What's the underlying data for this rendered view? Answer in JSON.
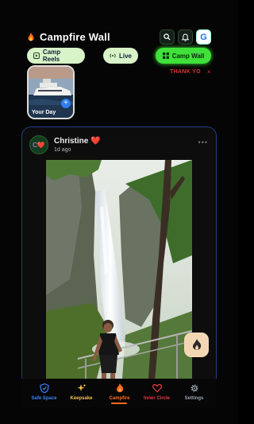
{
  "header": {
    "title": "Campfire Wall",
    "icons": [
      "search-icon",
      "bell-icon",
      "g-logo"
    ],
    "g_letter": "G"
  },
  "nav_chips": [
    {
      "label": "Camp Reels",
      "icon": "play-icon"
    },
    {
      "label": "Live",
      "icon": "broadcast-icon"
    },
    {
      "label": "Camp Wall",
      "icon": "grid-icon"
    }
  ],
  "notice": {
    "text": "THANK YO",
    "close": "×"
  },
  "story": {
    "label": "Your Day",
    "add": "+"
  },
  "post": {
    "author": "Christine ❤️",
    "time": "1d ago",
    "avatar_initial": "C❤️",
    "more": "•••"
  },
  "bottom_nav": [
    {
      "label": "Safe Space",
      "icon": "shield-icon",
      "color": "#3b82f6"
    },
    {
      "label": "Keepsake",
      "icon": "sparkle-icon",
      "color": "#f5c542"
    },
    {
      "label": "Campfire",
      "icon": "flame-icon",
      "color": "#ff6a1a"
    },
    {
      "label": "Inner Circle",
      "icon": "heart-icon",
      "color": "#e53945"
    },
    {
      "label": "Settings",
      "icon": "gear-icon",
      "color": "#9ca3af"
    }
  ],
  "colors": {
    "accent_green": "#3fe13a",
    "chip_bg": "#d8f3c8",
    "card_border": "#1f3f82",
    "active_tab": "#ff6a1a"
  }
}
